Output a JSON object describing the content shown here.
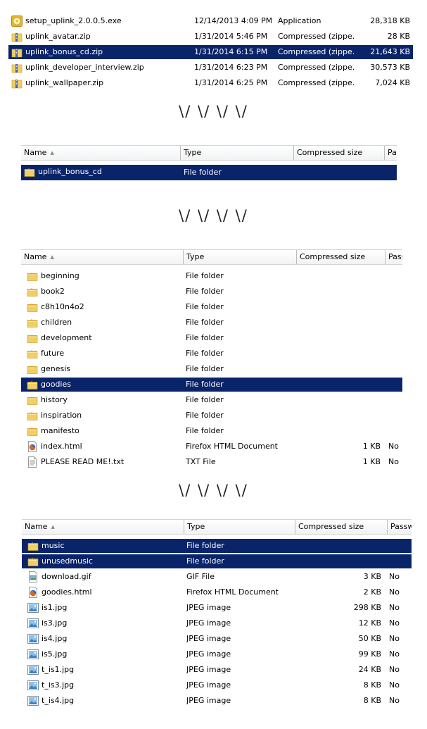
{
  "panel1": {
    "rows": [
      {
        "name": "setup_uplink_2.0.0.5.exe",
        "icon": "exe-disc-icon",
        "date": "12/14/2013 4:09 PM",
        "type": "Application",
        "size": "28,318 KB",
        "selected": false
      },
      {
        "name": "uplink_avatar.zip",
        "icon": "zip-icon",
        "date": "1/31/2014 5:46 PM",
        "type": "Compressed (zippe...",
        "size": "28 KB",
        "selected": false
      },
      {
        "name": "uplink_bonus_cd.zip",
        "icon": "zip-icon",
        "date": "1/31/2014 6:15 PM",
        "type": "Compressed (zippe...",
        "size": "21,643 KB",
        "selected": true
      },
      {
        "name": "uplink_developer_interview.zip",
        "icon": "zip-icon",
        "date": "1/31/2014 6:23 PM",
        "type": "Compressed (zippe...",
        "size": "30,573 KB",
        "selected": false
      },
      {
        "name": "uplink_wallpaper.zip",
        "icon": "zip-icon",
        "date": "1/31/2014 6:25 PM",
        "type": "Compressed (zippe...",
        "size": "7,024 KB",
        "selected": false
      }
    ]
  },
  "arrows": "\\/ \\/ \\/ \\/",
  "columns": {
    "name": "Name",
    "type": "Type",
    "compressed": "Compressed size",
    "pass_short": "Pas",
    "pass_mid": "Pass",
    "pass_long": "Passw"
  },
  "panel2": {
    "rows": [
      {
        "name": "uplink_bonus_cd",
        "icon": "folder-icon",
        "type": "File folder",
        "size": "",
        "pass": "",
        "selected": true
      }
    ]
  },
  "panel3": {
    "rows": [
      {
        "name": "beginning",
        "icon": "folder-icon",
        "type": "File folder",
        "size": "",
        "pass": "",
        "selected": false
      },
      {
        "name": "book2",
        "icon": "folder-icon",
        "type": "File folder",
        "size": "",
        "pass": "",
        "selected": false
      },
      {
        "name": "c8h10n4o2",
        "icon": "folder-icon",
        "type": "File folder",
        "size": "",
        "pass": "",
        "selected": false
      },
      {
        "name": "children",
        "icon": "folder-icon",
        "type": "File folder",
        "size": "",
        "pass": "",
        "selected": false
      },
      {
        "name": "development",
        "icon": "folder-icon",
        "type": "File folder",
        "size": "",
        "pass": "",
        "selected": false
      },
      {
        "name": "future",
        "icon": "folder-icon",
        "type": "File folder",
        "size": "",
        "pass": "",
        "selected": false
      },
      {
        "name": "genesis",
        "icon": "folder-icon",
        "type": "File folder",
        "size": "",
        "pass": "",
        "selected": false
      },
      {
        "name": "goodies",
        "icon": "folder-icon",
        "type": "File folder",
        "size": "",
        "pass": "",
        "selected": true
      },
      {
        "name": "history",
        "icon": "folder-icon",
        "type": "File folder",
        "size": "",
        "pass": "",
        "selected": false
      },
      {
        "name": "inspiration",
        "icon": "folder-icon",
        "type": "File folder",
        "size": "",
        "pass": "",
        "selected": false
      },
      {
        "name": "manifesto",
        "icon": "folder-icon",
        "type": "File folder",
        "size": "",
        "pass": "",
        "selected": false
      },
      {
        "name": "index.html",
        "icon": "firefox-html-icon",
        "type": "Firefox HTML Document",
        "size": "1 KB",
        "pass": "No",
        "selected": false
      },
      {
        "name": "PLEASE READ ME!.txt",
        "icon": "text-file-icon",
        "type": "TXT File",
        "size": "1 KB",
        "pass": "No",
        "selected": false
      }
    ]
  },
  "panel4": {
    "rows": [
      {
        "name": "music",
        "icon": "folder-icon",
        "type": "File folder",
        "size": "",
        "pass": "",
        "selected": true
      },
      {
        "name": "unusedmusic",
        "icon": "folder-icon",
        "type": "File folder",
        "size": "",
        "pass": "",
        "selected": true
      },
      {
        "name": "download.gif",
        "icon": "gif-file-icon",
        "type": "GIF File",
        "size": "3 KB",
        "pass": "No",
        "selected": false
      },
      {
        "name": "goodies.html",
        "icon": "firefox-html-icon",
        "type": "Firefox HTML Document",
        "size": "2 KB",
        "pass": "No",
        "selected": false
      },
      {
        "name": "is1.jpg",
        "icon": "jpeg-image-icon",
        "type": "JPEG image",
        "size": "298 KB",
        "pass": "No",
        "selected": false
      },
      {
        "name": "is3.jpg",
        "icon": "jpeg-image-icon",
        "type": "JPEG image",
        "size": "12 KB",
        "pass": "No",
        "selected": false
      },
      {
        "name": "is4.jpg",
        "icon": "jpeg-image-icon",
        "type": "JPEG image",
        "size": "50 KB",
        "pass": "No",
        "selected": false
      },
      {
        "name": "is5.jpg",
        "icon": "jpeg-image-icon",
        "type": "JPEG image",
        "size": "99 KB",
        "pass": "No",
        "selected": false
      },
      {
        "name": "t_is1.jpg",
        "icon": "jpeg-image-icon",
        "type": "JPEG image",
        "size": "24 KB",
        "pass": "No",
        "selected": false
      },
      {
        "name": "t_is3.jpg",
        "icon": "jpeg-image-icon",
        "type": "JPEG image",
        "size": "8 KB",
        "pass": "No",
        "selected": false
      },
      {
        "name": "t_is4.jpg",
        "icon": "jpeg-image-icon",
        "type": "JPEG image",
        "size": "8 KB",
        "pass": "No",
        "selected": false
      }
    ]
  },
  "colors": {
    "selection": "#0a246a",
    "folder": "#e8c35a",
    "zip_band": "#3f5fb5"
  }
}
